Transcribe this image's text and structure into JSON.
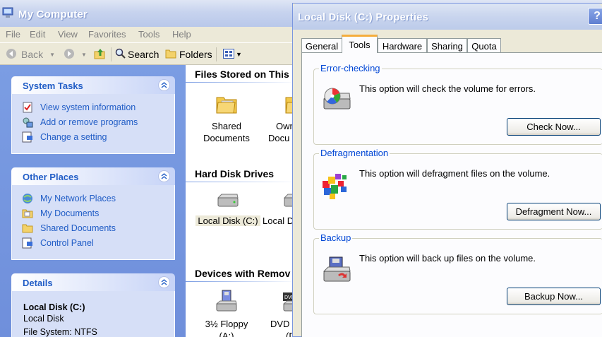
{
  "window": {
    "title": "My Computer"
  },
  "menu": [
    "File",
    "Edit",
    "View",
    "Favorites",
    "Tools",
    "Help"
  ],
  "toolbar": {
    "back": "Back",
    "search": "Search",
    "folders": "Folders"
  },
  "task_pane": {
    "system_tasks": {
      "title": "System Tasks",
      "items": [
        "View system information",
        "Add or remove programs",
        "Change a setting"
      ]
    },
    "other_places": {
      "title": "Other Places",
      "items": [
        "My Network Places",
        "My Documents",
        "Shared Documents",
        "Control Panel"
      ]
    },
    "details": {
      "title": "Details",
      "name": "Local Disk (C:)",
      "type": "Local Disk",
      "filesystem": "File System: NTFS"
    }
  },
  "content": {
    "groups": {
      "files_stored": "Files Stored on This",
      "hard_disks": "Hard Disk Drives",
      "removable": "Devices with Remov"
    },
    "items": {
      "shared_docs_1": "Shared",
      "shared_docs_2": "Documents",
      "own_docs_1": "Own",
      "own_docs_2": "Docu",
      "local_disk_c": "Local Disk (C:)",
      "local_disk_partial": "Local D",
      "floppy_1": "3½ Floppy",
      "floppy_2": "(A:)",
      "dvd_1": "DVD",
      "dvd_2": "(D"
    }
  },
  "dialog": {
    "title": "Local Disk (C:) Properties",
    "help": "?",
    "tabs": [
      "General",
      "Tools",
      "Hardware",
      "Sharing",
      "Quota"
    ],
    "active_tab": "Tools",
    "sections": [
      {
        "title": "Error-checking",
        "text": "This option will check the volume for errors.",
        "button": "Check Now..."
      },
      {
        "title": "Defragmentation",
        "text": "This option will defragment files on the volume.",
        "button": "Defragment Now..."
      },
      {
        "title": "Backup",
        "text": "This option will back up files on the volume.",
        "button": "Backup Now..."
      }
    ]
  },
  "colors": {
    "task_link": "#215dc6",
    "pane_bg": "#7b9de3",
    "group_title": "#0046d5",
    "tab_highlight": "#f5ad3c"
  }
}
